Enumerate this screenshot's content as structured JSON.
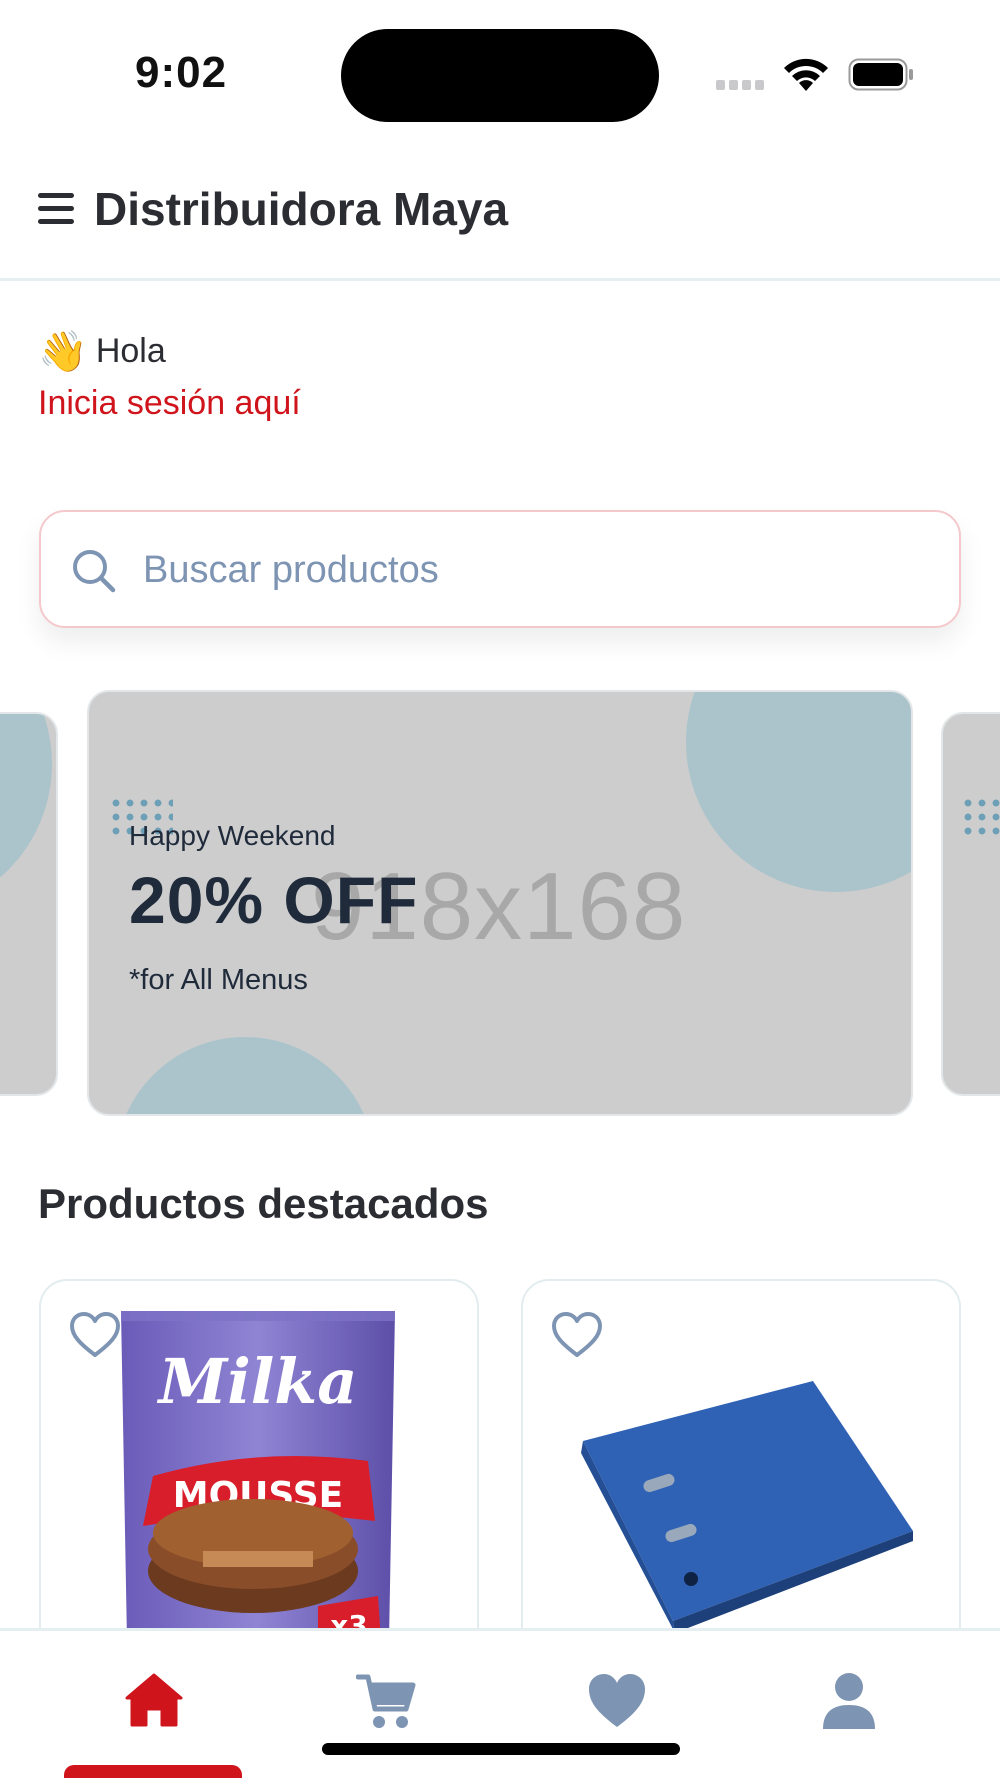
{
  "status_bar": {
    "time": "9:02"
  },
  "app_bar": {
    "menu_icon": "hamburger-menu-icon",
    "title": "Distribuidora Maya"
  },
  "greeting": {
    "emoji": "👋",
    "text": "Hola",
    "login_link": "Inicia sesión aquí"
  },
  "search": {
    "placeholder": "Buscar productos",
    "value": "",
    "icon": "search-icon"
  },
  "carousel": {
    "banners": [
      {
        "kicker": "Happy Weekend",
        "headline": "20% OFF",
        "note": "*for All Menus",
        "placeholder": "918x168"
      }
    ]
  },
  "featured": {
    "title": "Productos destacados",
    "products": [
      {
        "image": "milka-mousse-chocolate-pack",
        "favorite": false
      },
      {
        "image": "blue-ring-binder-folder",
        "favorite": false
      }
    ]
  },
  "bottom_nav": {
    "items": [
      {
        "icon": "home-icon",
        "active": true
      },
      {
        "icon": "cart-icon",
        "active": false
      },
      {
        "icon": "heart-icon",
        "active": false
      },
      {
        "icon": "user-icon",
        "active": false
      }
    ]
  },
  "colors": {
    "accent": "#d0141c",
    "text_primary": "#2b2d33",
    "icon_inactive": "#7e94b3",
    "banner_bg": "#cdcdcd",
    "banner_circle": "#abc4cc"
  }
}
